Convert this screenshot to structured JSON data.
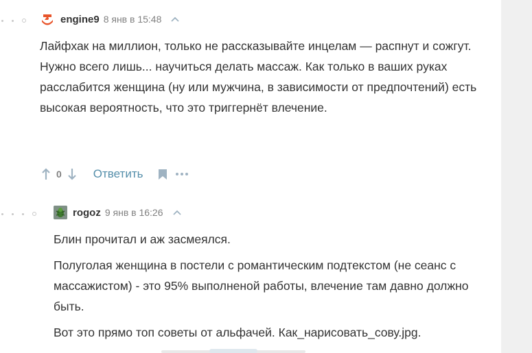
{
  "comments": [
    {
      "user": "engine9",
      "date": "8 янв в 15:48",
      "paragraphs": [
        "Лайфхак на миллион, только не рассказывайте инцелам — распнут и сожгут. Нужно всего лишь... научиться делать массаж. Как только в ваших руках расслабится женщина (ну или мужчина, в зависимости от предпочтений) есть высокая вероятность, что это триггернёт влечение."
      ],
      "votes": "0",
      "reply_label": "Ответить"
    },
    {
      "user": "rogoz",
      "date": "9 янв в 16:26",
      "paragraphs": [
        "Блин прочитал и аж засмеялся.",
        "Полуголая женщина в постели с романтическим подтекстом (не сеанс с массажистом) - это 95% выполненой работы, влечение там давно должно быть.",
        "Вот это прямо топ советы от альфачей. Как_нарисовать_сову.jpg."
      ]
    }
  ],
  "colors": {
    "link": "#548eaa",
    "muted": "#808080",
    "engine9_avatar": "#e8542a"
  }
}
